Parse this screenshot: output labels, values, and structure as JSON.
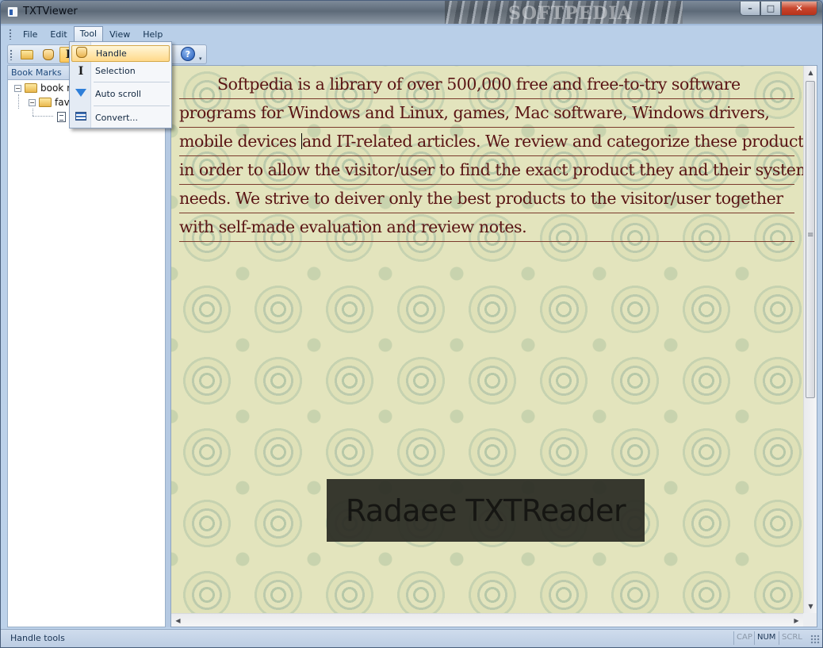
{
  "window": {
    "title": "TXTViewer",
    "controls": {
      "minimize": "–",
      "maximize": "□",
      "close": "✕"
    }
  },
  "menubar": {
    "items": [
      {
        "label": "File"
      },
      {
        "label": "Edit"
      },
      {
        "label": "Tool",
        "active": true
      },
      {
        "label": "View"
      },
      {
        "label": "Help"
      }
    ]
  },
  "toolbar": {
    "buttons": [
      "open-folder-icon",
      "hand-icon",
      "selection-icon",
      "help-icon"
    ],
    "help_glyph": "?",
    "overflow_glyph": "▾"
  },
  "tool_menu": {
    "items": [
      {
        "label": "Handle",
        "icon": "hand-icon",
        "highlighted": true
      },
      {
        "label": "Selection",
        "icon": "selection-icon"
      },
      {
        "label": "Auto scroll",
        "icon": "auto-scroll-icon"
      },
      {
        "label": "Convert...",
        "icon": "convert-icon"
      }
    ]
  },
  "sidebar": {
    "header": "Book Marks",
    "tree": [
      {
        "label": "book r",
        "depth": 0,
        "type": "folder",
        "toggle": "−"
      },
      {
        "label": "fav",
        "depth": 1,
        "type": "folder",
        "toggle": "−"
      },
      {
        "label": "",
        "depth": 2,
        "type": "file"
      }
    ]
  },
  "document": {
    "lines": [
      "Softpedia is a library of over 500,000 free and free-to-try software",
      "programs for Windows and Linux, games, Mac software, Windows drivers,",
      "mobile devices ",
      "and IT-related articles. We review and categorize these products",
      " in order to allow the visitor/user to find the exact product they and their system",
      "needs. We strive to deiver only the best products to the visitor/user together",
      "with self-made evaluation and review notes."
    ],
    "caption": "Radaee TXTReader",
    "colors": {
      "text": "#5a1414",
      "rule": "#7b3a2c",
      "paper": "#e3e4bd"
    }
  },
  "scrollbars": {
    "up": "▲",
    "down": "▼",
    "left": "◀",
    "right": "▶"
  },
  "statusbar": {
    "message": "Handle tools",
    "indicators": [
      {
        "label": "CAP",
        "on": false
      },
      {
        "label": "NUM",
        "on": true
      },
      {
        "label": "SCRL",
        "on": false
      }
    ]
  }
}
